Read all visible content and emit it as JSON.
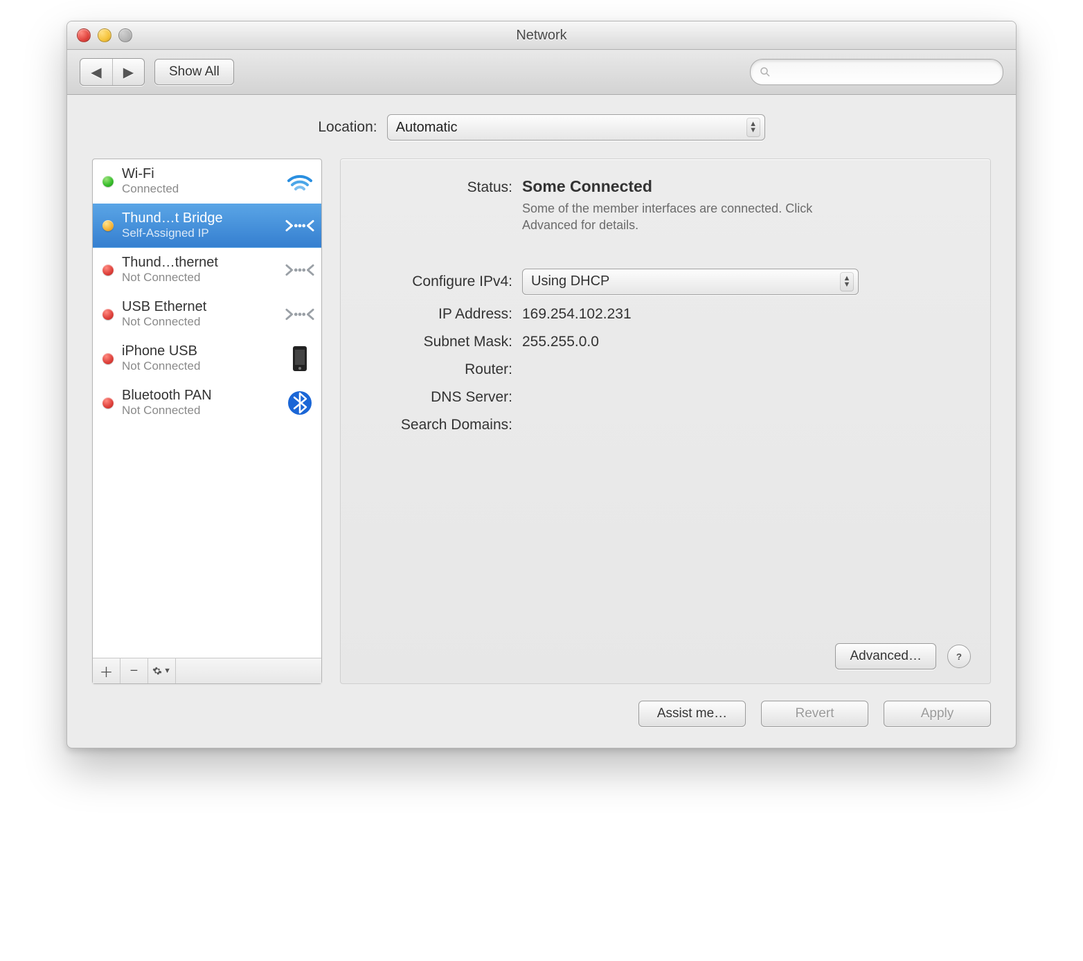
{
  "window": {
    "title": "Network"
  },
  "toolbar": {
    "show_all_label": "Show All",
    "search_placeholder": ""
  },
  "location": {
    "label": "Location:",
    "value": "Automatic"
  },
  "services": [
    {
      "name": "Wi-Fi",
      "status": "Connected",
      "dot": "green",
      "icon": "wifi",
      "selected": false
    },
    {
      "name": "Thund…t Bridge",
      "status": "Self-Assigned IP",
      "dot": "yellow",
      "icon": "ethernet",
      "selected": true
    },
    {
      "name": "Thund…thernet",
      "status": "Not Connected",
      "dot": "red",
      "icon": "ethernet",
      "selected": false
    },
    {
      "name": "USB Ethernet",
      "status": "Not Connected",
      "dot": "red",
      "icon": "ethernet",
      "selected": false
    },
    {
      "name": "iPhone USB",
      "status": "Not Connected",
      "dot": "red",
      "icon": "phone",
      "selected": false
    },
    {
      "name": "Bluetooth PAN",
      "status": "Not Connected",
      "dot": "red",
      "icon": "bluetooth",
      "selected": false
    }
  ],
  "detail": {
    "status_label": "Status:",
    "status_title": "Some Connected",
    "status_desc": "Some of the member interfaces are connected. Click Advanced for details.",
    "configure_label": "Configure IPv4:",
    "configure_value": "Using DHCP",
    "ip_label": "IP Address:",
    "ip_value": "169.254.102.231",
    "subnet_label": "Subnet Mask:",
    "subnet_value": "255.255.0.0",
    "router_label": "Router:",
    "router_value": "",
    "dns_label": "DNS Server:",
    "dns_value": "",
    "search_label": "Search Domains:",
    "search_value": "",
    "advanced_label": "Advanced…",
    "help_label": "?"
  },
  "buttons": {
    "assist": "Assist me…",
    "revert": "Revert",
    "apply": "Apply"
  }
}
